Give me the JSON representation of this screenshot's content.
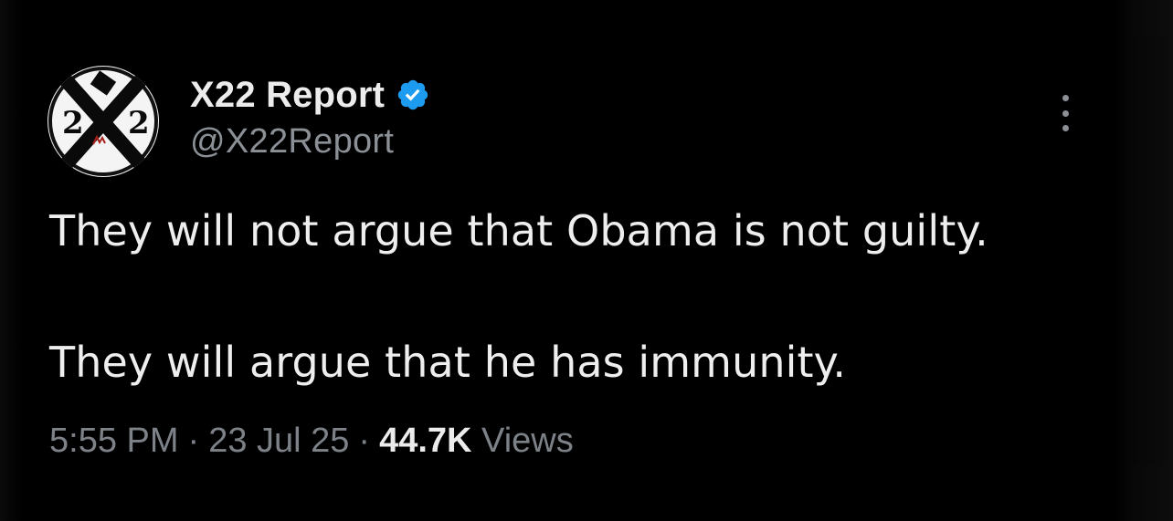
{
  "tweet": {
    "display_name": "X22 Report",
    "handle": "@X22Report",
    "verified": true,
    "verified_color": "#1d9bf0",
    "avatar_text_left": "2",
    "avatar_text_center": "X",
    "avatar_text_right": "2",
    "text_line_1": "They will not argue that Obama is not guilty.",
    "text_line_2": "They will argue that he has immunity.",
    "time": "5:55 PM",
    "date": "23 Jul 25",
    "views_count": "44.7K",
    "views_label": "Views",
    "separator": "·"
  },
  "icons": {
    "more": "more-vertical-icon",
    "verified": "verified-badge-icon"
  }
}
